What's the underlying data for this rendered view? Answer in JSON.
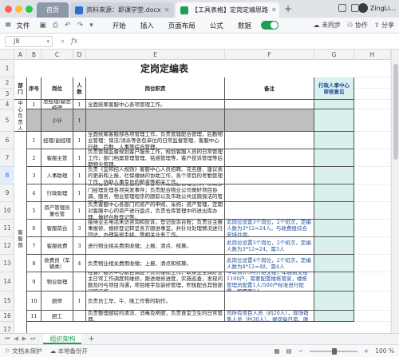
{
  "window": {
    "tabs": [
      {
        "label": "首页"
      },
      {
        "label": "资料来源：即课学堂.docx"
      },
      {
        "label": "【工具表格】定岗定编思路"
      }
    ],
    "user_name": "ZingLi..."
  },
  "menu": {
    "file": "文件",
    "items": [
      "开始",
      "插入",
      "页面布局",
      "公式",
      "数据"
    ],
    "right": [
      "未同步",
      "协作",
      "分享"
    ]
  },
  "formula": {
    "cell_ref": "J8",
    "fx": "fx"
  },
  "columns": [
    "A",
    "B",
    "C",
    "D",
    "E",
    "F",
    "G",
    "H"
  ],
  "rows": [
    "1",
    "2",
    "3",
    "4",
    "5",
    "6",
    "7",
    "8",
    "9",
    "10",
    "11",
    "12",
    "13",
    "14",
    "15",
    "16",
    "17",
    "18"
  ],
  "sheet": {
    "title": "定岗定编表",
    "headers": {
      "dept": "部门",
      "seq": "序号",
      "post": "岗位",
      "count": "人数",
      "duty": "岗位职责",
      "remark": "备注",
      "admin": "行政人事中心审核意见"
    },
    "dept_top": "中心负责人",
    "dept_bottom": "客服部",
    "rows": [
      {
        "seq": "1",
        "post": "总经理/副总经理",
        "count": "1",
        "duty": "全面统筹客服中心各项管理工作。",
        "remark": ""
      },
      {
        "seq": "",
        "post": "小计",
        "count": "1",
        "duty": "",
        "remark": ""
      },
      {
        "seq": "1",
        "post": "经理/副经理",
        "count": "1",
        "duty": "全面统筹客服部各项管理工作，负责管辖配合管理，后勤物业管理：保洁/消杀等各包单位的日常监督管理、客服中心行政、后勤、人事等综合管理。",
        "remark": ""
      },
      {
        "seq": "2",
        "post": "客服主管",
        "count": "1",
        "duty": "负责管辖监督规划客户服务工作，规划客服人员的日常管理工作；部门档案管理管理、铭感管理等，客户投诉管理等后期物业管理。",
        "remark": ""
      },
      {
        "seq": "3",
        "post": "人事助理",
        "count": "1",
        "duty": "负责《宜邦招人规则》客服中心人员招聘、花名册、建议表的更新和上报，社保缴纳的协助工作，各个项目的考勤管理工作，协助人事专员的薪资等相关工作。",
        "remark": ""
      },
      {
        "seq": "4",
        "post": "行政助理",
        "count": "1",
        "duty": "负责客服中心员工宿舍、食堂等行政后勤管理工作；协助部门经理处理各项突发事件；负责配合物业公司做好项目协调、服务，物业管理程序的跟踪以及市政公共设施保洁的管理事宜。",
        "remark": ""
      },
      {
        "seq": "5",
        "post": "资产管理员兼仓管",
        "count": "1",
        "duty": "负责客服中心各部门的资产的申购、采购；资产管理，定期对客服中心的资产进行盘点，负责仓库管理中的进出库办理、做好台账登记等。",
        "remark": ""
      },
      {
        "seq": "6",
        "post": "客服前台",
        "count": "3",
        "duty": "接待业主电话来访咨询和投诉，登记投诉台账；负责业主报事报修、报修登记转呈各方跟进事宜，并针对处理情况进行回访，办理装修手续、等相关业务工作。",
        "remark": "此岗位设置3个岗位，2个班次，定编人数为3*12=24人。与收费组综合安排住宿。"
      },
      {
        "seq": "7",
        "post": "客服收费",
        "count": "3",
        "duty": "进行物业相关费用收缴；上报、清点、核算。",
        "remark": "此岗位设置3个岗位，2个班次，定编人数为3*12=24，需3人"
      },
      {
        "seq": "8",
        "post": "收费员（车辆类）",
        "count": "4",
        "duty": "负责物业相关费用收缴；上报、清点和核算。",
        "remark": "此岗位设置4个岗位，2个班次，定编人数为4*12=48，需4人"
      },
      {
        "seq": "9",
        "post": "物业助理",
        "count": "",
        "duty": "在客户服务中心前台调度下负责楼栋工作，联系业主做好业主日常工作调度和维修，跟进维修进度，实施巡查，发现问题及时与项目沟通，项目楼宇及装修管理，积极配合其他部门的工作。",
        "remark": "今年预计5月开始交楼，年底前交楼1100户，需要配置楼栋管家，楼栋管理员配置1人/500户标准进行配置，即需要2人。"
      },
      {
        "seq": "10",
        "post": "厨师",
        "count": "1",
        "duty": "负责员工早、午、晚工作餐的制作。",
        "remark": ""
      },
      {
        "seq": "11",
        "post": "厨工",
        "count": "",
        "duty": "负责整理厨房的清洁、消毒及帮厨，负责食堂卫生的日常管理。",
        "remark": "此岗位设置在食堂就餐，包括地产公司所有项目人员（约20人），现场销售人员（约30人），督促每日早、晚班就餐。"
      }
    ]
  },
  "sheet_tabs": {
    "active": "组织架构"
  },
  "status": {
    "left": [
      "文档未保护",
      "本地备份开"
    ],
    "zoom": "100 %"
  }
}
